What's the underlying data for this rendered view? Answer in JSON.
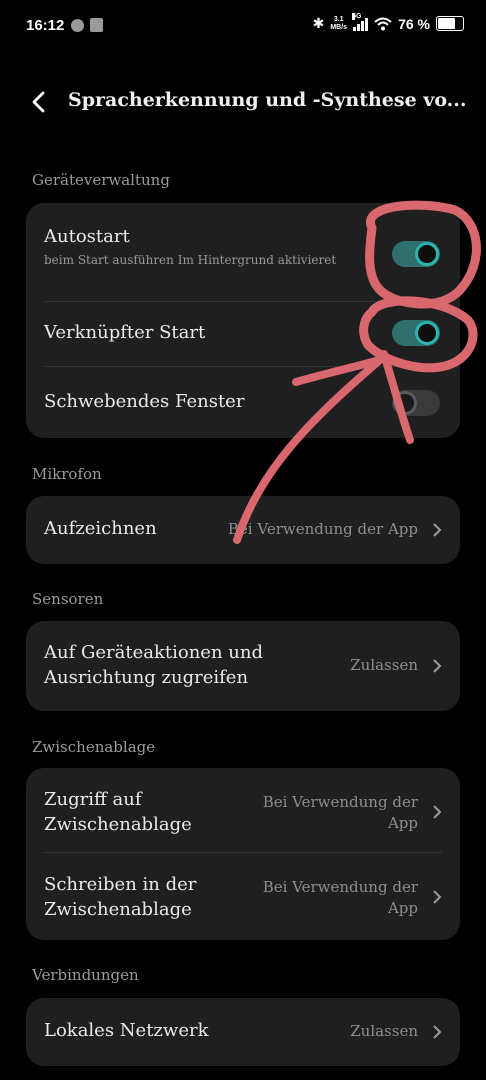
{
  "status_bar": {
    "time": "16:12",
    "net_speed_value": "3.1",
    "net_speed_unit": "MB/s",
    "signal_label": "5G",
    "battery": "76 %"
  },
  "header": {
    "title": "Spracherkennung und -Synthese vo..."
  },
  "sections": {
    "device_management": {
      "title": "Geräteverwaltung",
      "autostart": {
        "label": "Autostart",
        "sub": "beim Start ausführen  Im Hintergrund aktivieret",
        "enabled": true
      },
      "linked_start": {
        "label": "Verknüpfter Start",
        "enabled": true
      },
      "floating_window": {
        "label": "Schwebendes Fenster",
        "enabled": false
      }
    },
    "microphone": {
      "title": "Mikrofon",
      "record": {
        "label": "Aufzeichnen",
        "value": "Bei Verwendung der App"
      }
    },
    "sensors": {
      "title": "Sensoren",
      "device_actions": {
        "label_line1": "Auf Geräteaktionen und",
        "label_line2": "Ausrichtung zugreifen",
        "value": "Zulassen"
      }
    },
    "clipboard": {
      "title": "Zwischenablage",
      "access": {
        "label_line1": "Zugriff auf",
        "label_line2": "Zwischenablage",
        "value_line1": "Bei Verwendung der",
        "value_line2": "App"
      },
      "write": {
        "label_line1": "Schreiben in der",
        "label_line2": "Zwischenablage",
        "value_line1": "Bei Verwendung der",
        "value_line2": "App"
      }
    },
    "connections": {
      "title": "Verbindungen",
      "local_network": {
        "label": "Lokales Netzwerk",
        "value": "Zulassen"
      }
    }
  },
  "colors": {
    "background": "#000000",
    "card": "#1f1f1f",
    "accent": "#2ab3b0",
    "annotation": "#d9676e"
  },
  "icons": [
    "spotify-icon",
    "download-icon",
    "bluetooth-icon",
    "signal-icon",
    "wifi-icon",
    "battery-icon",
    "back-arrow-icon",
    "chevron-right-icon"
  ]
}
